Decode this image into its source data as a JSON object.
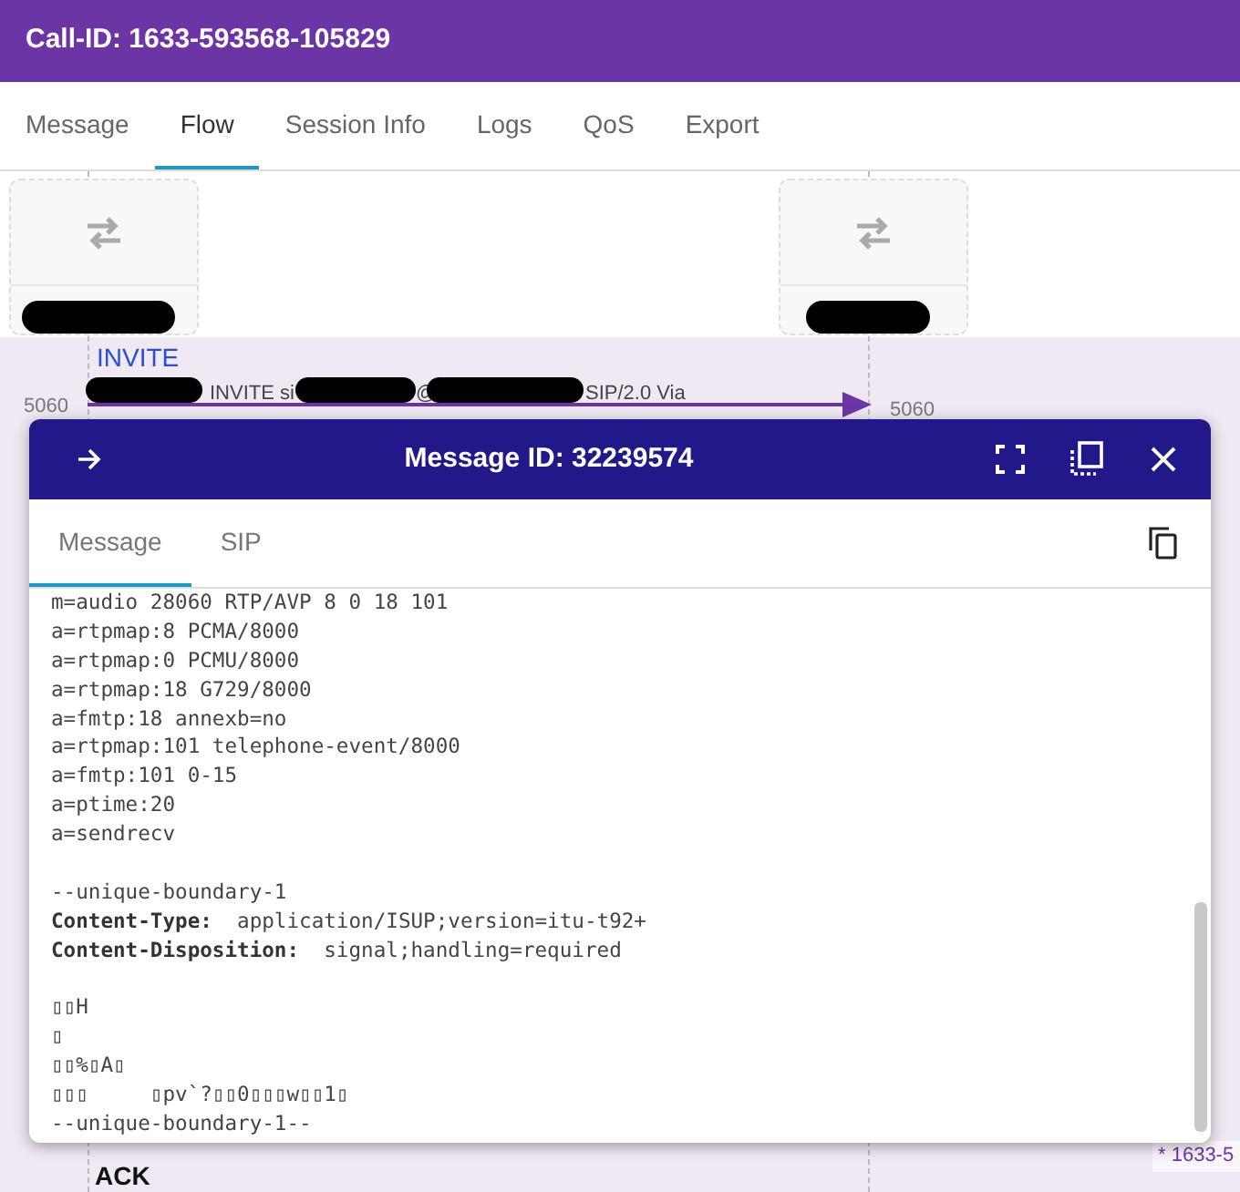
{
  "header": {
    "title": "Call-ID: 1633-593568-105829"
  },
  "tabs": [
    {
      "label": "Message",
      "selected": false
    },
    {
      "label": "Flow",
      "selected": true
    },
    {
      "label": "Session Info",
      "selected": false
    },
    {
      "label": "Logs",
      "selected": false
    },
    {
      "label": "QoS",
      "selected": false
    },
    {
      "label": "Export",
      "selected": false
    }
  ],
  "flow": {
    "nodes": [
      {
        "kind": "host"
      },
      {
        "kind": "host"
      }
    ],
    "messages": [
      {
        "method": "INVITE",
        "summary_parts": [
          "INVITE si",
          "@",
          "SIP/2.0 Via"
        ],
        "src_port": "5060",
        "dst_port": "5060"
      },
      {
        "method": "ACK"
      }
    ],
    "side_label": "* 1633-5"
  },
  "modal": {
    "title": "Message ID: 32239574",
    "tabs": [
      {
        "label": "Message",
        "selected": true
      },
      {
        "label": "SIP",
        "selected": false
      }
    ],
    "lines": [
      {
        "kind": "text",
        "text": "m=audio 28060 RTP/AVP 8 0 18 101"
      },
      {
        "kind": "text",
        "text": "a=rtpmap:8 PCMA/8000"
      },
      {
        "kind": "text",
        "text": "a=rtpmap:0 PCMU/8000"
      },
      {
        "kind": "text",
        "text": "a=rtpmap:18 G729/8000"
      },
      {
        "kind": "text",
        "text": "a=fmtp:18 annexb=no"
      },
      {
        "kind": "text",
        "text": "a=rtpmap:101 telephone-event/8000"
      },
      {
        "kind": "text",
        "text": "a=fmtp:101 0-15"
      },
      {
        "kind": "text",
        "text": "a=ptime:20"
      },
      {
        "kind": "text",
        "text": "a=sendrecv"
      },
      {
        "kind": "blank"
      },
      {
        "kind": "text",
        "text": "--unique-boundary-1"
      },
      {
        "kind": "header",
        "name": "Content-Type:",
        "value": "application/ISUP;version=itu-t92+"
      },
      {
        "kind": "header",
        "name": "Content-Disposition:",
        "value": "signal;handling=required"
      },
      {
        "kind": "blank"
      },
      {
        "kind": "text",
        "text": "▯▯H"
      },
      {
        "kind": "text",
        "text": "▯"
      },
      {
        "kind": "text",
        "text": "▯▯%▯A▯"
      },
      {
        "kind": "text",
        "text": "▯▯▯     ▯pv`?▯▯0▯▯▯w▯▯1▯"
      },
      {
        "kind": "text",
        "text": "--unique-boundary-1--"
      }
    ]
  }
}
